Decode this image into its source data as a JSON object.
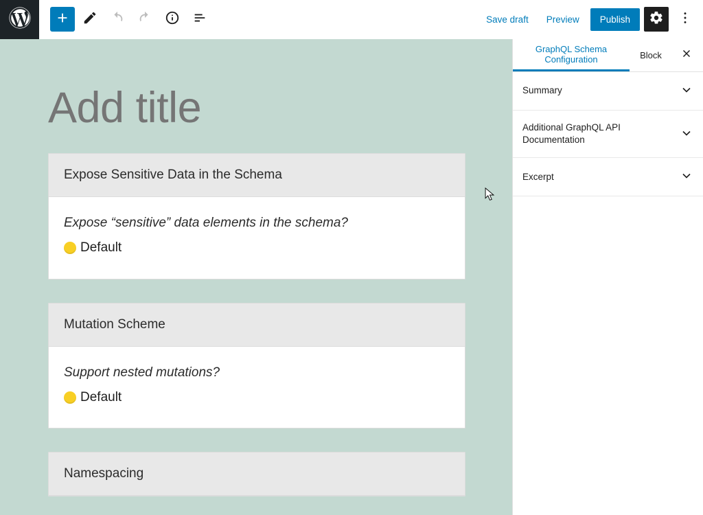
{
  "toolbar": {
    "save_draft": "Save draft",
    "preview": "Preview",
    "publish": "Publish"
  },
  "editor": {
    "title_placeholder": "Add title"
  },
  "cards": [
    {
      "header": "Expose Sensitive Data in the Schema",
      "prompt": "Expose “sensitive” data elements in the schema?",
      "value": "Default"
    },
    {
      "header": "Mutation Scheme",
      "prompt": "Support nested mutations?",
      "value": "Default"
    },
    {
      "header": "Namespacing",
      "prompt": "",
      "value": ""
    }
  ],
  "sidebar": {
    "tabs": {
      "active": "GraphQL Schema\nConfiguration",
      "block": "Block"
    },
    "panels": [
      {
        "title": "Summary"
      },
      {
        "title": "Additional GraphQL API Documentation"
      },
      {
        "title": "Excerpt"
      }
    ]
  }
}
